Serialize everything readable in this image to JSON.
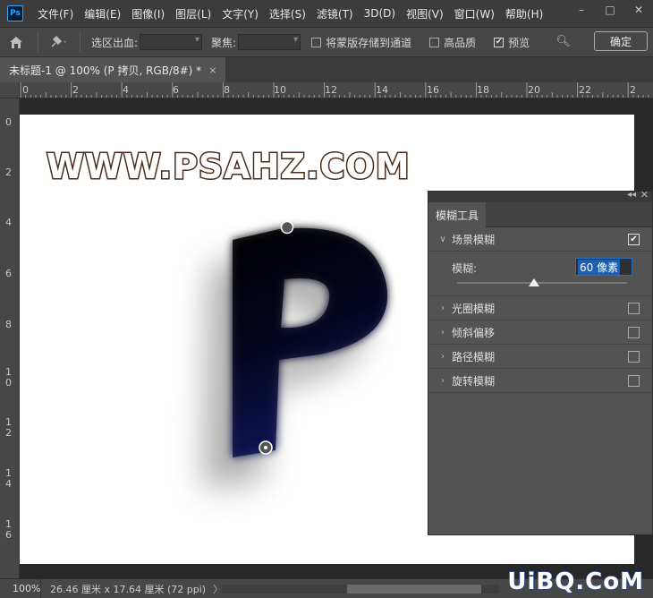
{
  "app": {
    "logo": "Ps"
  },
  "menu": [
    "文件(F)",
    "编辑(E)",
    "图像(I)",
    "图层(L)",
    "文字(Y)",
    "选择(S)",
    "滤镜(T)",
    "3D(D)",
    "视图(V)",
    "窗口(W)",
    "帮助(H)"
  ],
  "window_controls": {
    "minimize": "–",
    "maximize": "□",
    "close": "✕"
  },
  "options": {
    "selection_bleed_label": "选区出血:",
    "focus_label": "聚焦:",
    "save_mask_label": "将蒙版存储到通道",
    "save_mask_checked": false,
    "high_quality_label": "高品质",
    "high_quality_checked": false,
    "preview_label": "预览",
    "preview_checked": true,
    "ok_label": "确定"
  },
  "document_tab": {
    "title": "未标题-1 @ 100% (P 拷贝, RGB/8#) *",
    "close": "×"
  },
  "ruler_h": [
    "0",
    "2",
    "4",
    "6",
    "8",
    "10",
    "12",
    "14",
    "16",
    "18",
    "20",
    "22",
    "2"
  ],
  "ruler_v": [
    "0",
    "2",
    "4",
    "6",
    "8",
    "1\n0",
    "1\n2",
    "1\n4",
    "1\n6"
  ],
  "canvas": {
    "watermark": "WWW.PSAHZ.COM",
    "letter": "P"
  },
  "blur_panel": {
    "tab": "模糊工具",
    "field_blur": {
      "title": "场景模糊",
      "checked": true,
      "expanded": true
    },
    "blur_label": "模糊:",
    "blur_value": "60 像素",
    "blur_slider": 0.45,
    "sections": [
      {
        "title": "光圈模糊",
        "checked": false
      },
      {
        "title": "倾斜偏移",
        "checked": false
      },
      {
        "title": "路径模糊",
        "checked": false
      },
      {
        "title": "旋转模糊",
        "checked": false
      }
    ]
  },
  "status": {
    "zoom": "100%",
    "doc_info": "26.46 厘米 x 17.64 厘米 (72 ppi)",
    "arrow": "〉",
    "brand": "UiBQ.CoM"
  },
  "colors": {
    "letter": "#0d1250",
    "accent": "#31a8ff"
  }
}
